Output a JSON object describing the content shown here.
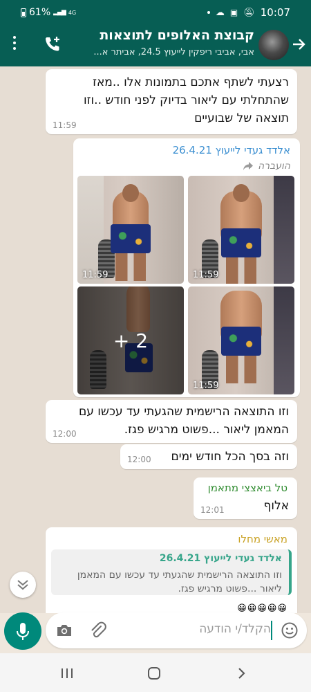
{
  "status": {
    "battery": "61%",
    "network": "4G",
    "time": "10:07"
  },
  "header": {
    "title": "קבוצת האלופים לתוצאות",
    "subtitle": "אבי, אביבי ריפקין לייעוץ 24.5, אביתר א..."
  },
  "messages": {
    "m1": {
      "lines": [
        "רצעתי לשתף אתכם בתמונות אלו ..מאז",
        "שהתחלתי עם ליאור בדיוק לפני חודש ..וזו",
        "תוצאה של שבועיים"
      ],
      "time": "11:59"
    },
    "m2": {
      "sender": "אלדד געדי לייעוץ 26.4.21",
      "forwarded_label": "הועברה",
      "photo_times": [
        "11:59",
        "11:59",
        "11:59"
      ],
      "more_count": "+ 2"
    },
    "m3": {
      "lines": [
        "וזו התוצאה הרישמית שהגעתי עד עכשו עם",
        "המאמן ליאור ...פשוט מרגיש פגז."
      ],
      "time": "12:00"
    },
    "m4": {
      "text": "וזה בסך הכל חודש ימים",
      "time": "12:00"
    },
    "m5": {
      "sender": "טל ביאצצי מתאמן",
      "text": "אלוף",
      "time": "12:01"
    },
    "m6": {
      "sender": "מאשי מחלו",
      "quote_sender": "אלדד געדי לייעוץ 26.4.21",
      "quote_lines": [
        "וזו התוצאה הרישמית שהגעתי עד עכשו עם המאמן",
        "ליאור ...פשוט מרגיש פגז."
      ]
    }
  },
  "input": {
    "placeholder": "הקלד/י הודעה"
  },
  "colors": {
    "header": "#075e54",
    "accent": "#00897b",
    "quote_bar": "#36a58a",
    "sender_blue": "#3b8fd1",
    "sender_green": "#2e8b2e",
    "sender_gold": "#c8a020"
  }
}
